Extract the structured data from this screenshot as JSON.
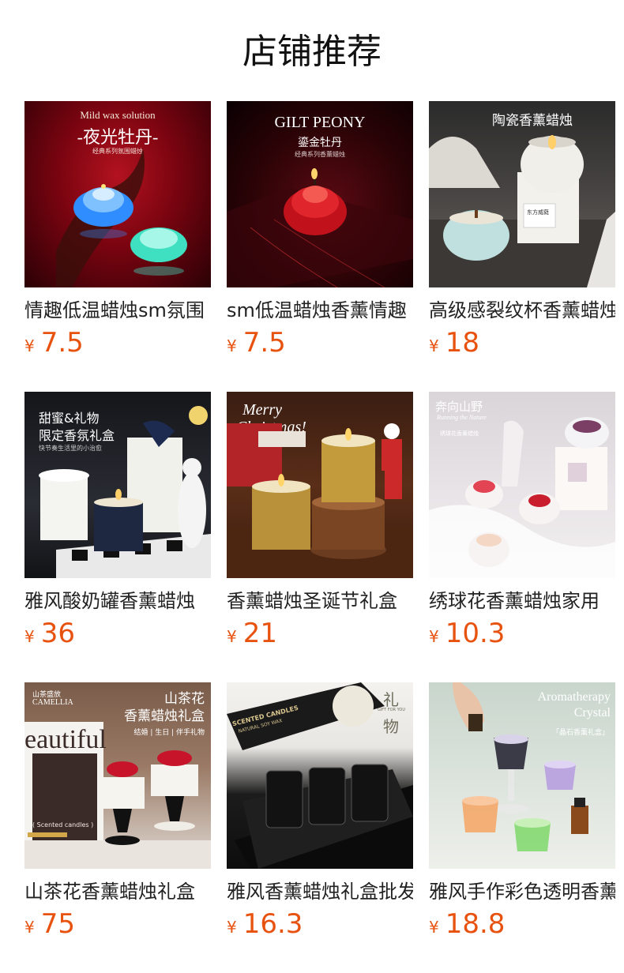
{
  "header": {
    "title": "店铺推荐"
  },
  "products": [
    {
      "title": "情趣低温蜡烛sm氛围",
      "currency": "¥",
      "price": "7.5",
      "image_text": [
        "Mild wax solution",
        "-夜光牡丹-",
        "经典系列氛围蜡烛"
      ]
    },
    {
      "title": "sm低温蜡烛香薰情趣",
      "currency": "¥",
      "price": "7.5",
      "image_text": [
        "GILT PEONY",
        "鎏金牡丹",
        "经典系列香薰蜡烛"
      ]
    },
    {
      "title": "高级感裂纹杯香薰蜡烛",
      "currency": "¥",
      "price": "18",
      "image_text": [
        "陶瓷香薰蜡烛",
        "东方威蕤"
      ]
    },
    {
      "title": "雅风酸奶罐香薰蜡烛",
      "currency": "¥",
      "price": "36",
      "image_text": [
        "甜蜜&礼物",
        "限定香氛礼盒",
        "快节奏生活里的小治愈"
      ]
    },
    {
      "title": "香薰蜡烛圣诞节礼盒",
      "currency": "¥",
      "price": "21",
      "image_text": [
        "Merry",
        "Christmas!"
      ]
    },
    {
      "title": "绣球花香薰蜡烛家用",
      "currency": "¥",
      "price": "10.3",
      "image_text": [
        "奔向山野",
        "Running the Nature",
        "绣球花香薰蜡烛"
      ]
    },
    {
      "title": "山茶花香薰蜡烛礼盒",
      "currency": "¥",
      "price": "75",
      "image_text": [
        "山茶盛放",
        "CAMELLIA",
        "山茶花",
        "香薰蜡烛礼盒",
        "结婚 | 生日 | 伴手礼物",
        "eautiful",
        "( Scented candles )"
      ]
    },
    {
      "title": "雅风香薰蜡烛礼盒批发",
      "currency": "¥",
      "price": "16.3",
      "image_text": [
        "SCENTED CANDLES",
        "NATURAL SOY WAX",
        "礼",
        "物",
        "GIFT FOR YOU"
      ]
    },
    {
      "title": "雅风手作彩色透明香薰",
      "currency": "¥",
      "price": "18.8",
      "image_text": [
        "Aromatherapy",
        "Crystal",
        "「晶石香薰礼盒」"
      ]
    }
  ]
}
